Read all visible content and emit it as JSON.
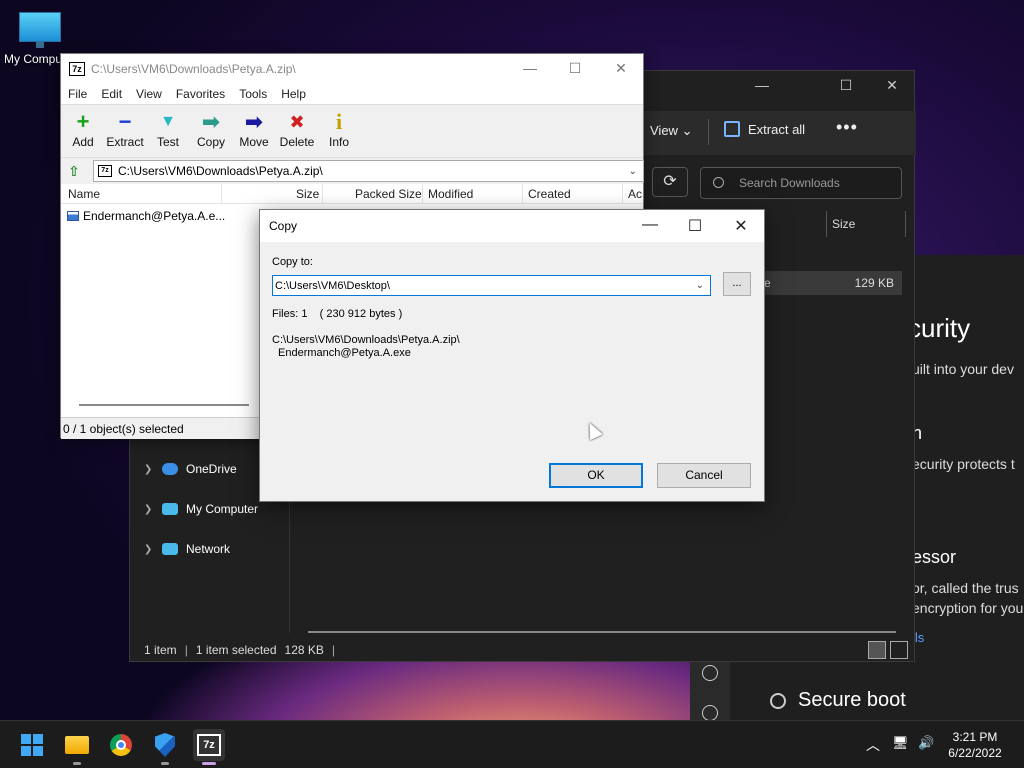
{
  "desktop": {
    "icon_label": "My Computer"
  },
  "explorer": {
    "view_label": "View",
    "view_chevron": "⌄",
    "extract_label": "Extract all",
    "more_label": "•••",
    "refresh_label": "⟳",
    "search_placeholder": "Search Downloads",
    "col_size": "Size",
    "row": {
      "name": "e",
      "size": "129 KB"
    },
    "nav": [
      {
        "label": "OneDrive",
        "color": "#3a8ee6"
      },
      {
        "label": "My Computer",
        "color": "#4ab8e8"
      },
      {
        "label": "Network",
        "color": "#4ab8e8"
      }
    ],
    "status_items": "1 item",
    "status_selected": "1 item selected",
    "status_size": "128 KB",
    "status_bar": "|",
    "ctrl_min": "—",
    "ctrl_max": "☐",
    "ctrl_close": "✕"
  },
  "security": {
    "heading": "curity",
    "line1": "uilt into your dev",
    "heading2": "n",
    "line2": "ecurity protects t",
    "heading3": "essor",
    "line3": "or, called the trus",
    "line4": "encryption for you",
    "link": "ils",
    "secure_boot": "Secure boot"
  },
  "sevenzip": {
    "logo": "7z",
    "title": "C:\\Users\\VM6\\Downloads\\Petya.A.zip\\",
    "ctrl_min": "—",
    "ctrl_max": "☐",
    "ctrl_close": "✕",
    "menu": [
      "File",
      "Edit",
      "View",
      "Favorites",
      "Tools",
      "Help"
    ],
    "toolbar": [
      {
        "label": "Add",
        "icon": "+",
        "color": "#1aa01a"
      },
      {
        "label": "Extract",
        "icon": "−",
        "color": "#1a3ad0"
      },
      {
        "label": "Test",
        "icon": "▼",
        "color": "#2ab8c8"
      },
      {
        "label": "Copy",
        "icon": "➡",
        "color": "#2a9a8a"
      },
      {
        "label": "Move",
        "icon": "➡",
        "color": "#1a1aa0"
      },
      {
        "label": "Delete",
        "icon": "✖",
        "color": "#d02020"
      },
      {
        "label": "Info",
        "icon": "i",
        "color": "#c0a000"
      }
    ],
    "up_icon": "⇧",
    "address": "C:\\Users\\VM6\\Downloads\\Petya.A.zip\\",
    "address_chevron": "⌄",
    "columns": [
      "Name",
      "Size",
      "Packed Size",
      "Modified",
      "Created",
      "Ac"
    ],
    "file_name": "Endermanch@Petya.A.e...",
    "status": "0 / 1 object(s) selected"
  },
  "copy_dialog": {
    "title": "Copy",
    "ctrl_min": "—",
    "ctrl_max": "☐",
    "ctrl_close": "✕",
    "copy_to_label": "Copy to:",
    "destination": "C:\\Users\\VM6\\Desktop\\",
    "combo_chevron": "⌄",
    "browse_label": "...",
    "files_info": "Files: 1    ( 230 912 bytes )",
    "source_path": "C:\\Users\\VM6\\Downloads\\Petya.A.zip\\",
    "source_file": "Endermanch@Petya.A.exe",
    "ok_label": "OK",
    "cancel_label": "Cancel"
  },
  "taskbar": {
    "sz_icon": "7z",
    "tray_chevron": "︿",
    "tray_network": "🖥",
    "tray_volume": "🔊",
    "time": "3:21 PM",
    "date": "6/22/2022"
  }
}
